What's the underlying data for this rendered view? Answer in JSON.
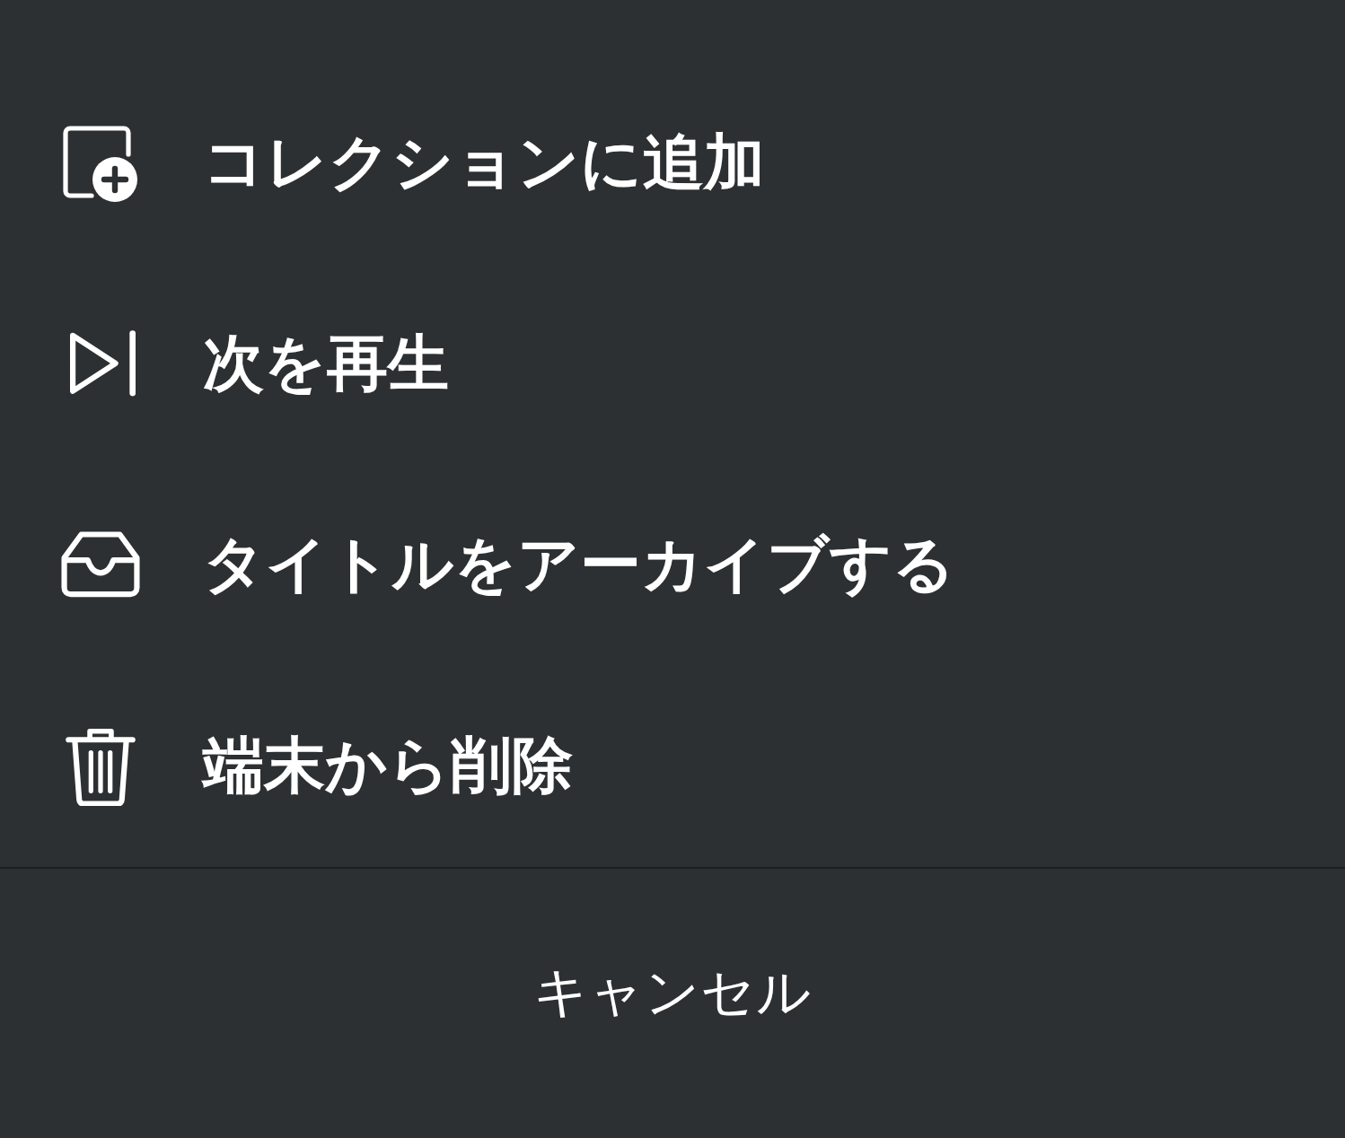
{
  "actions": [
    {
      "kind": "add-to-collection",
      "label": "コレクションに追加"
    },
    {
      "kind": "play-next",
      "label": "次を再生"
    },
    {
      "kind": "archive",
      "label": "タイトルをアーカイブする"
    },
    {
      "kind": "delete",
      "label": "端末から削除"
    }
  ],
  "cancel": {
    "label": "キャンセル"
  }
}
